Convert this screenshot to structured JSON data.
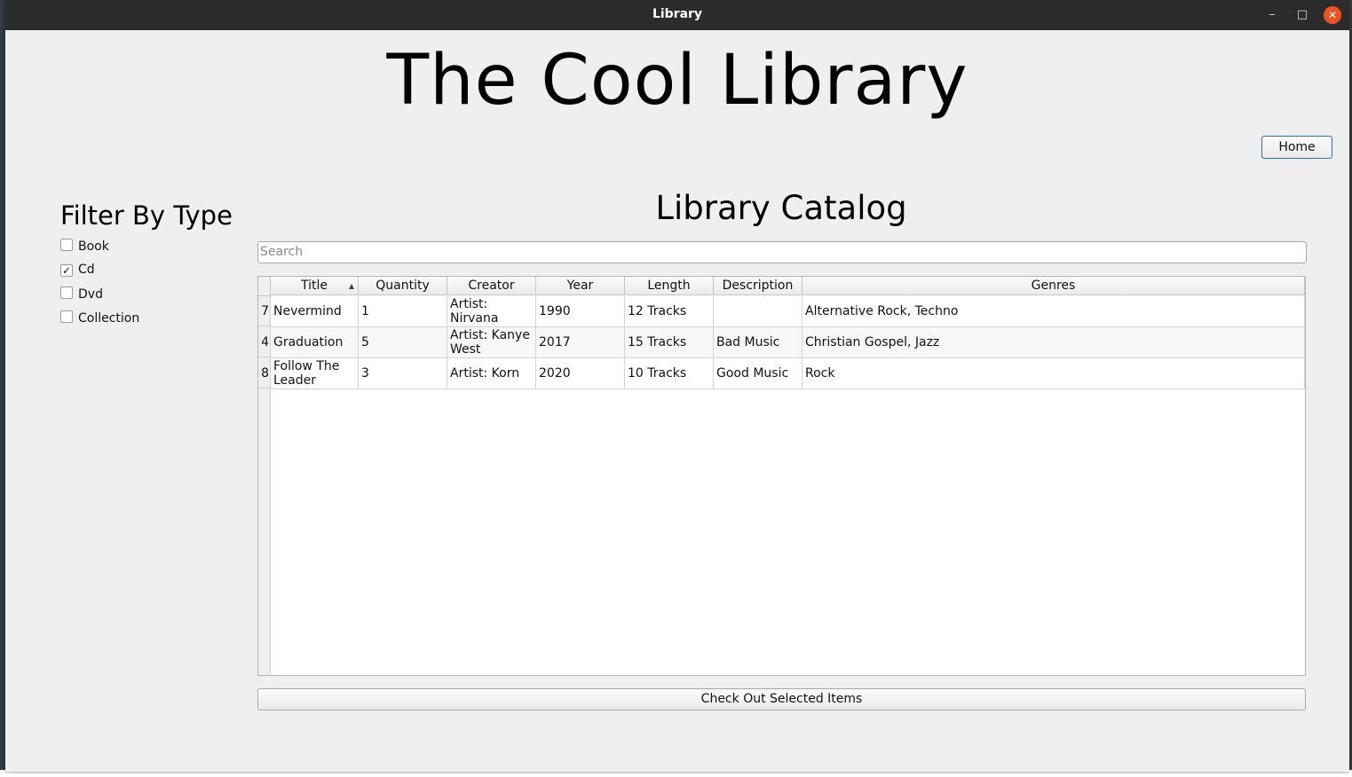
{
  "window": {
    "title": "Library",
    "minimize_glyph": "–",
    "maximize_glyph": "□",
    "close_glyph": "✕"
  },
  "header": {
    "app_title": "The Cool Library",
    "home_label": "Home"
  },
  "filter": {
    "title": "Filter By Type",
    "items": [
      {
        "label": "Book",
        "checked": false,
        "mark": ""
      },
      {
        "label": "Cd",
        "checked": true,
        "mark": "✓"
      },
      {
        "label": "Dvd",
        "checked": false,
        "mark": ""
      },
      {
        "label": "Collection",
        "checked": false,
        "mark": ""
      }
    ]
  },
  "catalog": {
    "title": "Library Catalog",
    "search_placeholder": "Search",
    "columns": [
      "Title",
      "Quantity",
      "Creator",
      "Year",
      "Length",
      "Description",
      "Genres"
    ],
    "sort_indicator": "▲",
    "rows": [
      {
        "id": "7",
        "cells": [
          "Nevermind",
          "1",
          "Artist: Nirvana",
          "1990",
          "12 Tracks",
          "",
          "Alternative Rock, Techno"
        ]
      },
      {
        "id": "4",
        "cells": [
          "Graduation",
          "5",
          "Artist: Kanye West",
          "2017",
          "15 Tracks",
          "Bad Music",
          "Christian Gospel, Jazz"
        ]
      },
      {
        "id": "8",
        "cells": [
          "Follow The Leader",
          "3",
          "Artist: Korn",
          "2020",
          "10 Tracks",
          "Good Music",
          "Rock"
        ]
      }
    ],
    "checkout_label": "Check Out Selected Items"
  }
}
